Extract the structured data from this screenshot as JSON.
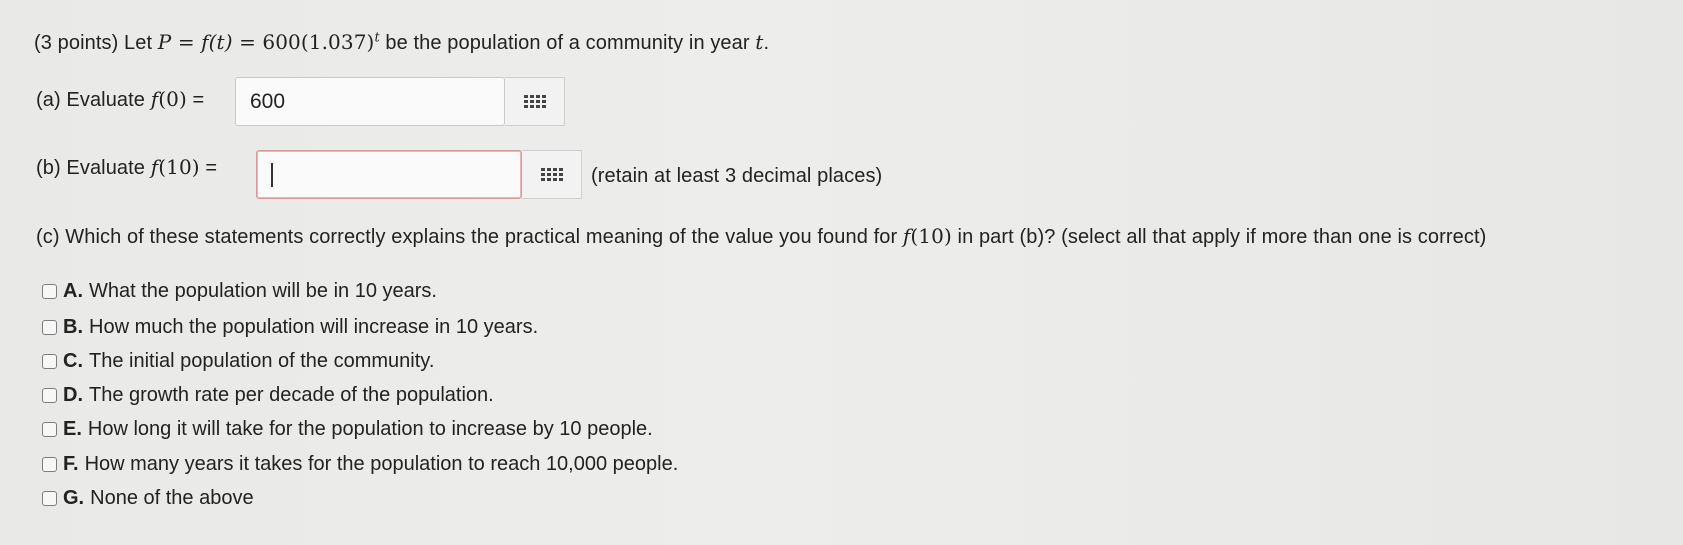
{
  "question": {
    "points": "(3 points) Let ",
    "definition": {
      "var": "P",
      "eq1": " = ",
      "func": "f",
      "arg": "(t)",
      "eq2": " = ",
      "base": "600(1.037)",
      "exp": "t"
    },
    "suffix": " be the population of a community in year ",
    "year_var": "t",
    "period": "."
  },
  "part_a": {
    "prefix": "(a) Evaluate ",
    "func": "f",
    "arg": "(0)",
    "equals": " = ",
    "value": "600"
  },
  "part_b": {
    "prefix": "(b) Evaluate ",
    "func": "f",
    "arg": "(10)",
    "equals": " = ",
    "value": "",
    "hint": "(retain at least 3 decimal places)"
  },
  "part_c": {
    "prefix": "(c) Which of these statements correctly explains the practical meaning of the value you found for ",
    "func": "f",
    "arg": "(10)",
    "suffix": " in part (b)? (select all that apply if more than one is correct)"
  },
  "options": [
    {
      "letter": "A.",
      "text": "What the population will be in 10 years."
    },
    {
      "letter": "B.",
      "text": "How much the population will increase in 10 years."
    },
    {
      "letter": "C.",
      "text": "The initial population of the community."
    },
    {
      "letter": "D.",
      "text": "The growth rate per decade of the population."
    },
    {
      "letter": "E.",
      "text": "How long it will take for the population to increase by 10 people."
    },
    {
      "letter": "F.",
      "text": "How many years it takes for the population to reach 10,000 people."
    },
    {
      "letter": "G.",
      "text": "None of the above"
    }
  ]
}
